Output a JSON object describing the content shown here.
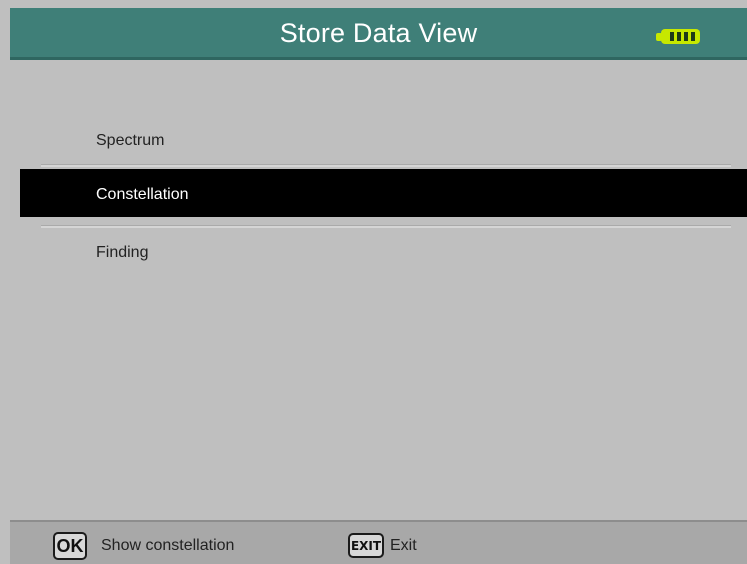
{
  "header": {
    "title": "Store Data View",
    "battery": {
      "icon": "battery-icon",
      "level": "full",
      "color": "#c7e800"
    }
  },
  "menu": {
    "selected": "Constellation",
    "items": [
      {
        "label": "Spectrum"
      },
      {
        "label": "Constellation"
      },
      {
        "label": "Finding"
      }
    ]
  },
  "footer": {
    "actions": [
      {
        "key": "OK",
        "label": "Show constellation"
      },
      {
        "key": "EXIT",
        "label": "Exit"
      }
    ]
  },
  "colors": {
    "header_background": "#3f7f78",
    "screen_background": "#bfbfbf",
    "selected_row": "#000000",
    "footer_background": "#a8a8a8"
  }
}
